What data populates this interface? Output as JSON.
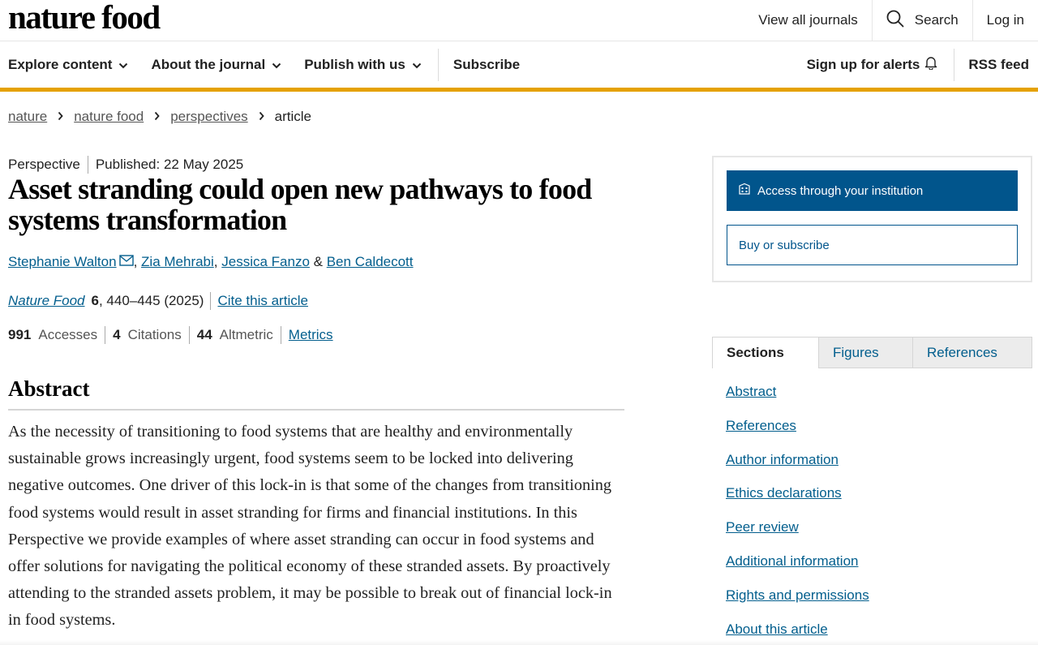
{
  "header": {
    "logo": "nature food",
    "view_all": "View all journals",
    "search": "Search",
    "login": "Log in"
  },
  "nav": {
    "explore": "Explore content",
    "about": "About the journal",
    "publish": "Publish with us",
    "subscribe": "Subscribe",
    "alerts": "Sign up for alerts",
    "rss": "RSS feed"
  },
  "breadcrumb": {
    "items": [
      "nature",
      "nature food",
      "perspectives"
    ],
    "current": "article"
  },
  "article": {
    "type": "Perspective",
    "published": "Published: 22 May 2025",
    "title": "Asset stranding could open new pathways to food systems transformation",
    "authors": [
      "Stephanie Walton",
      "Zia Mehrabi",
      "Jessica Fanzo",
      "Ben Caldecott"
    ],
    "journal_name": "Nature Food",
    "volume": "6",
    "pages": ", 440–445 (2025)",
    "cite": "Cite this article",
    "metrics": {
      "accesses_value": "991",
      "accesses_label": "Accesses",
      "citations_value": "4",
      "citations_label": "Citations",
      "altmetric_value": "44",
      "altmetric_label": "Altmetric",
      "link": "Metrics"
    }
  },
  "abstract": {
    "heading": "Abstract",
    "text": "As the necessity of transitioning to food systems that are healthy and environmentally sustainable grows increasingly urgent, food systems seem to be locked into delivering negative outcomes. One driver of this lock-in is that some of the changes from transitioning food systems would result in asset stranding for firms and financial institutions. In this Perspective we provide examples of where asset stranding can occur in food systems and offer solutions for navigating the political economy of these stranded assets. By proactively attending to the stranded assets problem, it may be possible to break out of financial lock-in in food systems."
  },
  "access": {
    "institution": "Access through your institution",
    "buy": "Buy or subscribe"
  },
  "sidebar": {
    "tabs": [
      "Sections",
      "Figures",
      "References"
    ],
    "sections": [
      "Abstract",
      "References",
      "Author information",
      "Ethics declarations",
      "Peer review",
      "Additional information",
      "Rights and permissions",
      "About this article"
    ]
  }
}
